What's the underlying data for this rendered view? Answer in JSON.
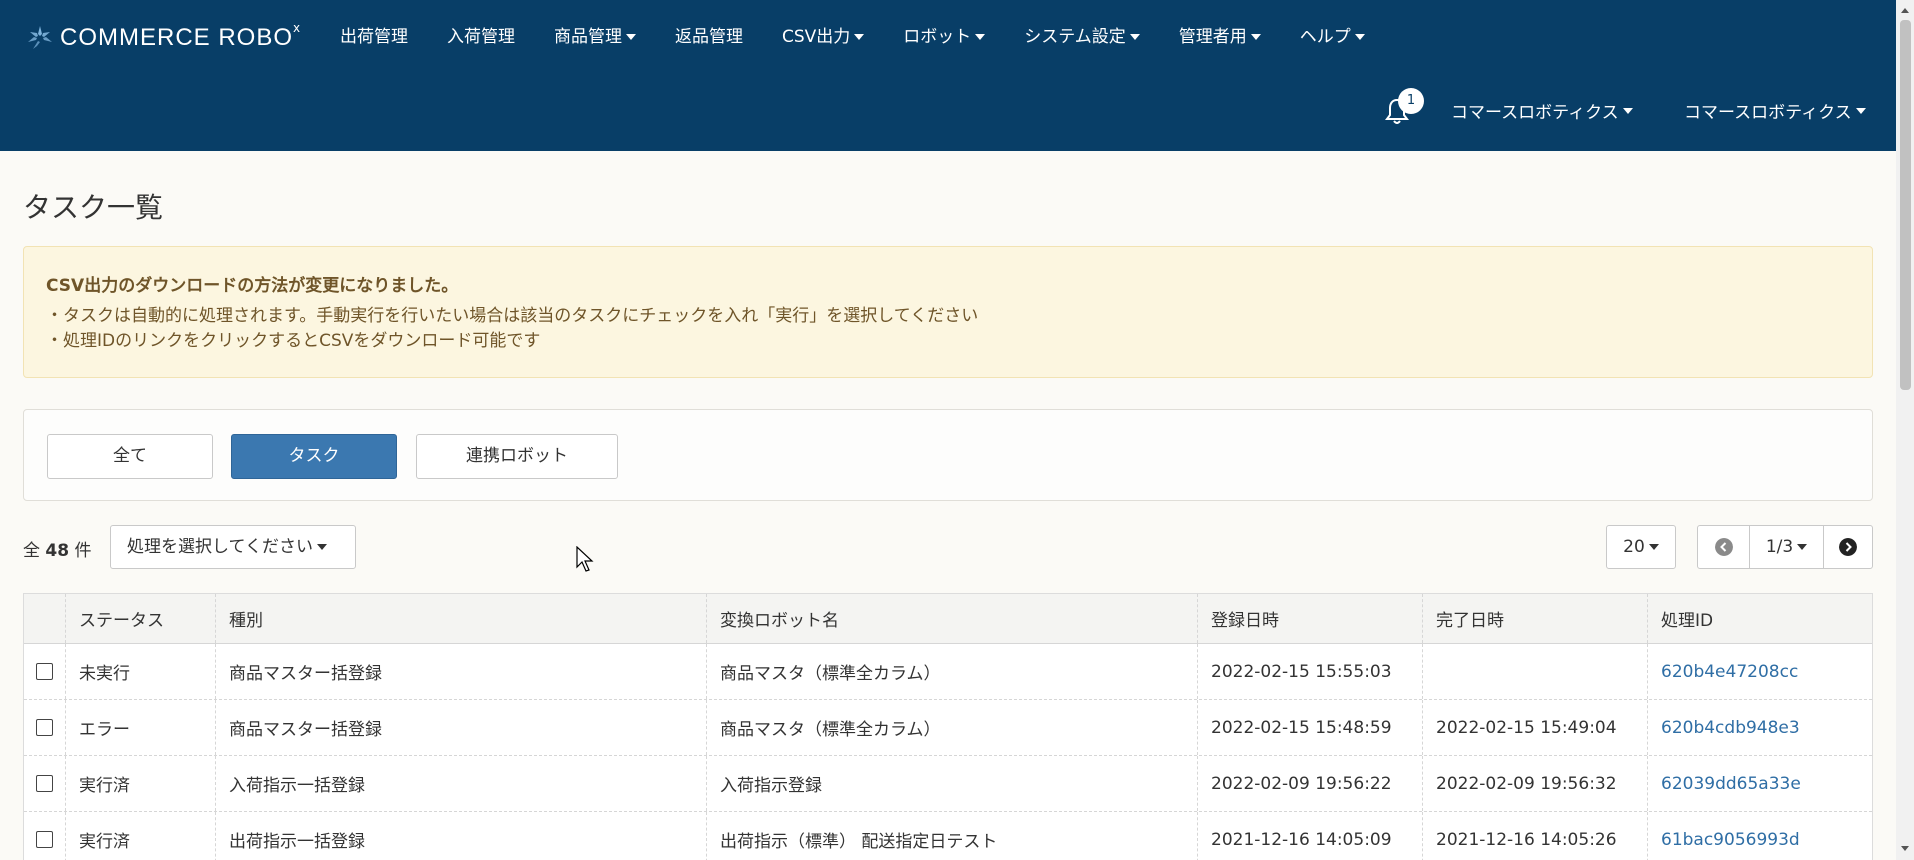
{
  "brand": {
    "name": "COMMERCE ROBO",
    "mark": "x"
  },
  "nav": [
    {
      "label": "出荷管理",
      "caret": false
    },
    {
      "label": "入荷管理",
      "caret": false
    },
    {
      "label": "商品管理",
      "caret": true
    },
    {
      "label": "返品管理",
      "caret": false
    },
    {
      "label": "CSV出力",
      "caret": true
    },
    {
      "label": "ロボット",
      "caret": true
    },
    {
      "label": "システム設定",
      "caret": true
    },
    {
      "label": "管理者用",
      "caret": true
    },
    {
      "label": "ヘルプ",
      "caret": true
    }
  ],
  "notifications": {
    "count": "1"
  },
  "user_menus": [
    "コマースロボティクス",
    "コマースロボティクス"
  ],
  "page": {
    "title": "タスク一覧"
  },
  "notice": {
    "title": "CSV出力のダウンロードの方法が変更になりました。",
    "lines": [
      "・タスクは自動的に処理されます。手動実行を行いたい場合は該当のタスクにチェックを入れ「実行」を選択してください",
      "・処理IDのリンクをクリックするとCSVをダウンロード可能です"
    ]
  },
  "filters": [
    {
      "label": "全て",
      "active": false
    },
    {
      "label": "タスク",
      "active": true
    },
    {
      "label": "連携ロボット",
      "active": false
    }
  ],
  "count": {
    "prefix": "全",
    "value": "48",
    "suffix": "件"
  },
  "action_select": {
    "label": "処理を選択してください"
  },
  "per_page": "20",
  "pager": {
    "page": "1/3"
  },
  "table": {
    "headers": [
      "ステータス",
      "種別",
      "変換ロボット名",
      "登録日時",
      "完了日時",
      "処理ID"
    ],
    "rows": [
      {
        "status": "未実行",
        "type": "商品マスター括登録",
        "robot": "商品マスタ（標準全カラム）",
        "registered": "2022-02-15 15:55:03",
        "completed": "",
        "id": "620b4e47208cc"
      },
      {
        "status": "エラー",
        "type": "商品マスター括登録",
        "robot": "商品マスタ（標準全カラム）",
        "registered": "2022-02-15 15:48:59",
        "completed": "2022-02-15 15:49:04",
        "id": "620b4cdb948e3"
      },
      {
        "status": "実行済",
        "type": "入荷指示一括登録",
        "robot": "入荷指示登録",
        "registered": "2022-02-09 19:56:22",
        "completed": "2022-02-09 19:56:32",
        "id": "62039dd65a33e"
      },
      {
        "status": "実行済",
        "type": "出荷指示一括登録",
        "robot": "出荷指示（標準） 配送指定日テスト",
        "registered": "2021-12-16 14:05:09",
        "completed": "2021-12-16 14:05:26",
        "id": "61bac9056993d"
      }
    ]
  },
  "colors": {
    "header_bg": "#083e67",
    "accent": "#3b78b0",
    "link": "#2f6ea5",
    "notice_bg": "#fcf6e0",
    "notice_text": "#6f5529"
  }
}
